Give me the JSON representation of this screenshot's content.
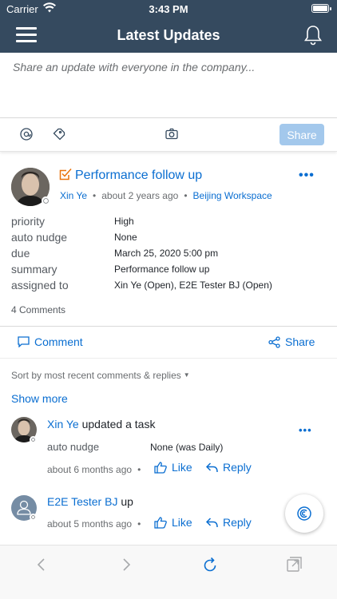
{
  "status_bar": {
    "carrier": "Carrier",
    "time": "3:43 PM"
  },
  "nav": {
    "title": "Latest Updates"
  },
  "composer": {
    "placeholder": "Share an update with everyone in the company...",
    "share_label": "Share"
  },
  "post": {
    "title": "Performance follow up",
    "author": "Xin Ye",
    "time": "about 2 years ago",
    "workspace": "Beijing Workspace",
    "fields": [
      {
        "label": "priority",
        "value": "High"
      },
      {
        "label": "auto nudge",
        "value": "None"
      },
      {
        "label": "due",
        "value": "March 25, 2020 5:00 pm"
      },
      {
        "label": "summary",
        "value": "Performance follow up"
      },
      {
        "label": "assigned to",
        "value": "Xin Ye (Open), E2E Tester BJ (Open)"
      }
    ],
    "comments_count": "4 Comments",
    "comment_label": "Comment",
    "share_label": "Share"
  },
  "comments_section": {
    "sort_label": "Sort by most recent comments & replies",
    "show_more": "Show more"
  },
  "comments": [
    {
      "author": "Xin Ye",
      "text": "updated a task",
      "field_label": "auto nudge",
      "field_value": "None (was Daily)",
      "time": "about 6 months ago",
      "like_label": "Like",
      "reply_label": "Reply"
    },
    {
      "author": "E2E Tester BJ",
      "text": "up",
      "time": "about 5 months ago",
      "like_label": "Like",
      "reply_label": "Reply"
    }
  ],
  "colors": {
    "header_bg": "#354a5f",
    "link": "#0a6ed1",
    "task_icon": "#e9730c",
    "share_button_disabled": "#a3c8ec"
  },
  "icons": {
    "menu": "hamburger-icon",
    "notifications": "bell-icon",
    "mention": "at-sign-icon",
    "tag": "tag-icon",
    "camera": "camera-icon",
    "task": "task-checkbox-icon",
    "more": "more-horizontal-icon",
    "comment": "comment-bubble-icon",
    "share": "share-icon",
    "like": "thumbs-up-icon",
    "reply": "reply-arrow-icon",
    "fab": "jam-logo-icon",
    "back": "chevron-left-icon",
    "forward": "chevron-right-icon",
    "refresh": "refresh-icon",
    "external": "open-external-icon"
  }
}
